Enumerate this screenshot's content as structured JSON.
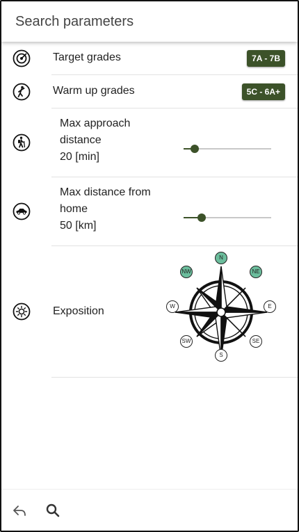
{
  "header": {
    "title": "Search parameters"
  },
  "rows": {
    "target": {
      "label": "Target grades",
      "chip": "7A - 7B",
      "icon": "target-icon"
    },
    "warmup": {
      "label": "Warm up grades",
      "chip": "5C - 6A+",
      "icon": "climber-icon"
    },
    "approach": {
      "label_line1": "Max approach",
      "label_line2": "distance",
      "value": "20 [min]",
      "slider_fraction": 0.13,
      "icon": "hiker-icon"
    },
    "home": {
      "label_line1": "Max distance from",
      "label_line2": "home",
      "value": "50 [km]",
      "slider_fraction": 0.21,
      "icon": "car-icon"
    },
    "exposition": {
      "label": "Exposition",
      "icon": "sun-icon"
    }
  },
  "compass": {
    "directions": [
      {
        "key": "n",
        "label": "N",
        "active": true
      },
      {
        "key": "ne",
        "label": "NE",
        "active": true
      },
      {
        "key": "e",
        "label": "E",
        "active": false
      },
      {
        "key": "se",
        "label": "SE",
        "active": false
      },
      {
        "key": "s",
        "label": "S",
        "active": false
      },
      {
        "key": "sw",
        "label": "SW",
        "active": false
      },
      {
        "key": "w",
        "label": "W",
        "active": false
      },
      {
        "key": "nw",
        "label": "NW",
        "active": true
      }
    ],
    "active_color": "#6bbd9c"
  },
  "colors": {
    "accent": "#3c5229",
    "chip_text": "#ffffff"
  },
  "footer": {
    "back_icon": "reply-icon",
    "search_icon": "search-icon"
  }
}
